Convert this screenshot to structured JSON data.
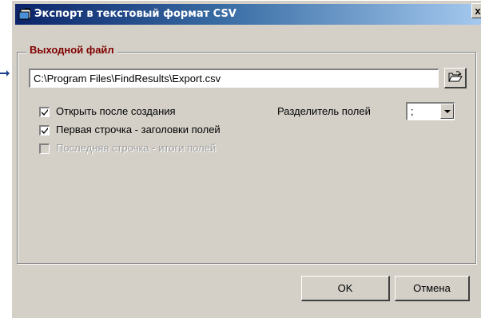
{
  "window": {
    "title": "Экспорт в текстовый формат CSV",
    "close_label": "x"
  },
  "output_group": {
    "legend": "Выходной файл",
    "file_path": "C:\\Program Files\\FindResults\\Export.csv",
    "browse_icon": "open-folder-icon"
  },
  "options": [
    {
      "label": "Открыть после создания",
      "checked": true,
      "enabled": true
    },
    {
      "label": "Первая строчка - заголовки полей",
      "checked": true,
      "enabled": true
    },
    {
      "label": "Последняя строчка - итоги полей",
      "checked": false,
      "enabled": false
    }
  ],
  "separator": {
    "label": "Разделитель полей",
    "value": ";"
  },
  "buttons": {
    "ok": "OK",
    "cancel": "Отмена"
  },
  "colors": {
    "legend": "#800000",
    "titlebar_start": "#0b246a",
    "titlebar_end": "#a6caf0",
    "pointer": "#1f3f8f"
  }
}
